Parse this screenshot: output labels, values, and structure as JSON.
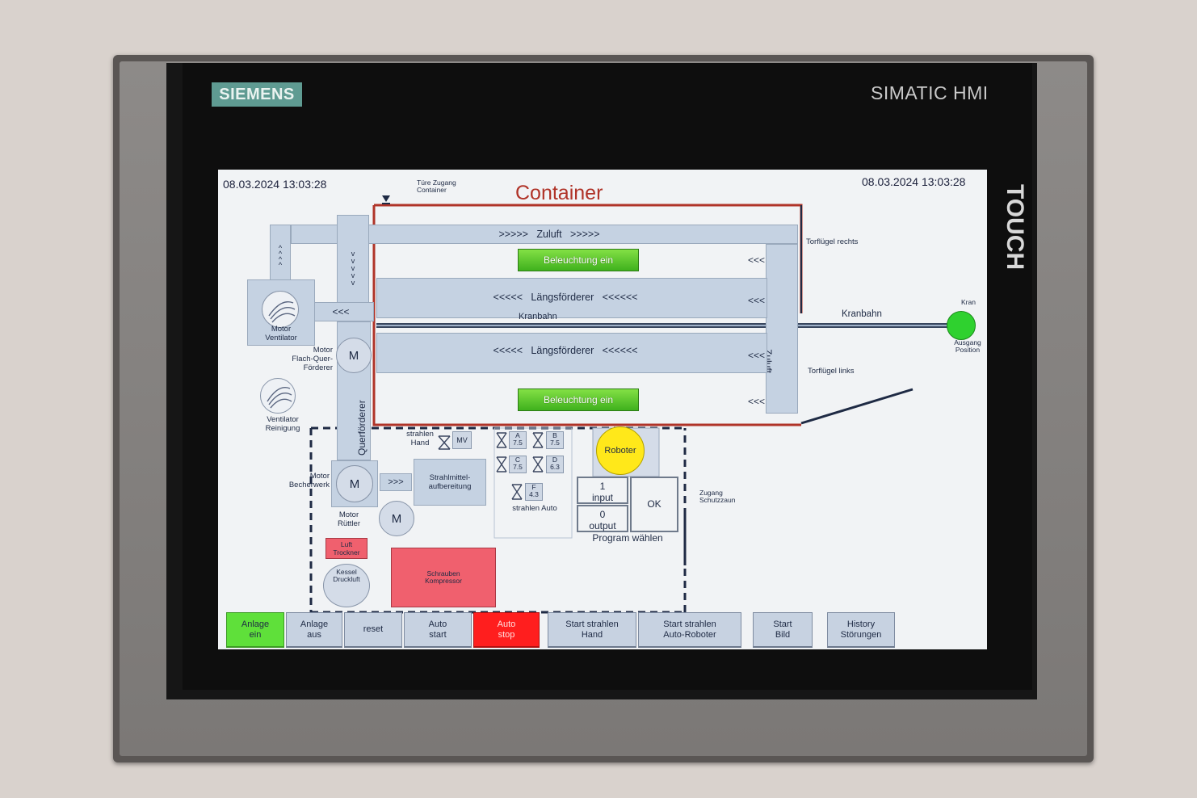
{
  "device": {
    "brand": "SIEMENS",
    "model": "SIMATIC HMI",
    "touch_label": "TOUCH"
  },
  "screen": {
    "datetime_left": "08.03.2024 13:03:28",
    "datetime_right": "08.03.2024 13:03:28",
    "door_access": "Türe Zugang\nContainer",
    "container_title": "Container",
    "zuluft_top": ">>>>>   Zuluft   >>>>>",
    "zuluft_side": "Zuluft",
    "laengsfoerderer_1": "<<<<<   Längsförderer   <<<<<<",
    "laengsfoerderer_2": "<<<<<   Längsförderer   <<<<<<",
    "kranbahn_inner": "Kranbahn",
    "kranbahn_outer": "Kranbahn",
    "beleuchtung_1": "Beleuchtung ein",
    "beleuchtung_2": "Beleuchtung ein",
    "arrows_left": "<<<",
    "arrows_up": "^\n^\n^\n^",
    "arrows_down": "v\nv\nv\nv\nv",
    "arrows_right_1": "<<<",
    "arrows_right_2": "<<<",
    "arrows_right_3": "<<<",
    "arrows_right_4": "<<<",
    "arrows_strahl": ">>>",
    "torfluegel_rechts": "Torflügel rechts",
    "torfluegel_links": "Torflügel links",
    "kran_label": "Kran",
    "kran_position": "Ausgang\nPosition",
    "motor_ventilator": "Motor\nVentilator",
    "motor_flach_quer": "Motor\nFlach-Quer-\nFörderer",
    "ventilator_reinigung": "Ventilator\nReinigung",
    "querfoerderer": "Querförderer",
    "motor_becherwerk": "Motor\nBecherwerk",
    "motor_ruettler": "Motor\nRüttler",
    "motor_letter": "M",
    "strahlmittel": "Strahlmittel-\naufbereitung",
    "luft_trockner": "Luft\nTrockner",
    "kessel_druckluft": "Kessel\nDruckluft",
    "schrauben_kompressor": "Schrauben\nKompressor",
    "strahlen_hand": "strahlen\nHand",
    "mv": "MV",
    "nozzles": [
      {
        "letter": "A",
        "value": "7.5"
      },
      {
        "letter": "B",
        "value": "7.5"
      },
      {
        "letter": "C",
        "value": "7.5"
      },
      {
        "letter": "D",
        "value": "6.3"
      },
      {
        "letter": "F",
        "value": "4.3"
      }
    ],
    "strahlen_auto": "strahlen Auto",
    "roboter": "Roboter",
    "input_box": "1\ninput",
    "output_box": "0\noutput",
    "ok_button": "OK",
    "program_waehlen": "Program wählen",
    "zugang_schutzzaun": "Zugang\nSchutzzaun"
  },
  "buttons": [
    {
      "id": "anlage-ein",
      "label": "Anlage\nein",
      "state": "green"
    },
    {
      "id": "anlage-aus",
      "label": "Anlage\naus",
      "state": "normal"
    },
    {
      "id": "reset",
      "label": "reset",
      "state": "normal"
    },
    {
      "id": "auto-start",
      "label": "Auto\nstart",
      "state": "normal"
    },
    {
      "id": "auto-stop",
      "label": "Auto\nstop",
      "state": "red"
    },
    {
      "id": "start-strahlen-hand",
      "label": "Start strahlen\nHand",
      "state": "normal"
    },
    {
      "id": "start-strahlen-auto-roboter",
      "label": "Start strahlen\nAuto-Roboter",
      "state": "normal"
    },
    {
      "id": "start-bild",
      "label": "Start\nBild",
      "state": "normal"
    },
    {
      "id": "history-stoerungen",
      "label": "History\nStörungen",
      "state": "normal"
    }
  ],
  "colors": {
    "active_green": "#5fe03a",
    "stop_red": "#ff1e1e",
    "container_outline": "#b03328",
    "kran_indicator": "#2fd12f",
    "roboter_indicator": "#ffe81a",
    "compressor_pink": "#f0606e"
  }
}
